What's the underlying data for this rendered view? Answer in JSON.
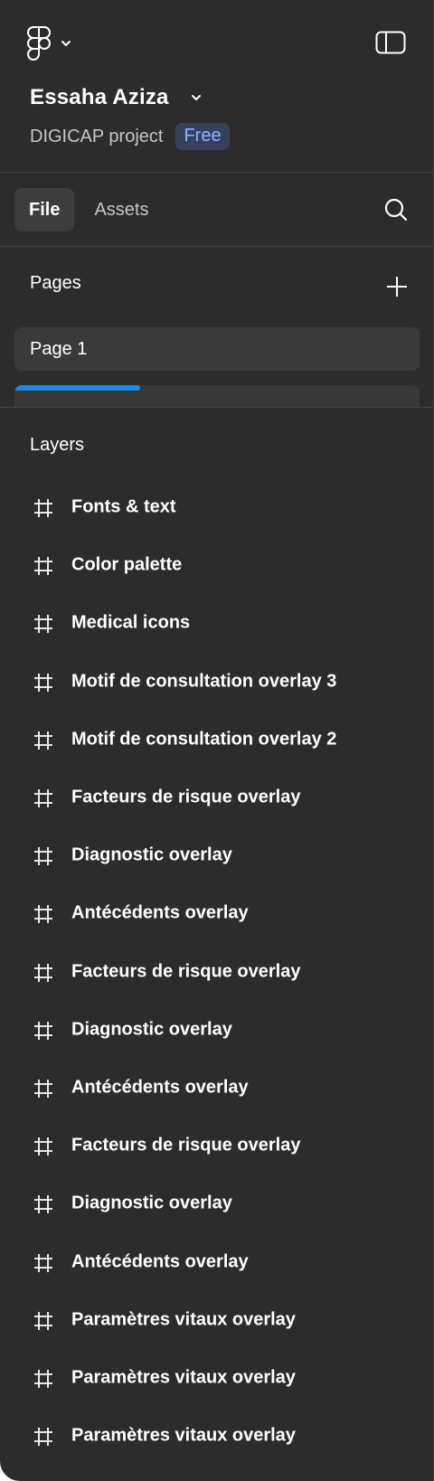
{
  "header": {
    "workspace_name": "Essaha Aziza",
    "project_name": "DIGICAP project",
    "plan_badge": "Free",
    "icons": {
      "logo": "figma-logo-icon",
      "logo_menu": "chevron-down-icon",
      "sidebar_toggle": "sidebar-toggle-icon"
    }
  },
  "tabs": [
    {
      "label": "File",
      "active": true
    },
    {
      "label": "Assets",
      "active": false
    }
  ],
  "pages": {
    "title": "Pages",
    "items": [
      {
        "label": "Page 1",
        "selected": true
      }
    ],
    "scroll_fraction": 0.31
  },
  "layers": {
    "title": "Layers",
    "items": [
      {
        "label": "Fonts & text"
      },
      {
        "label": "Color palette"
      },
      {
        "label": "Medical icons"
      },
      {
        "label": "Motif de consultation overlay 3"
      },
      {
        "label": "Motif de consultation overlay 2"
      },
      {
        "label": "Facteurs de risque overlay"
      },
      {
        "label": "Diagnostic overlay"
      },
      {
        "label": "Antécédents overlay"
      },
      {
        "label": "Facteurs de risque overlay"
      },
      {
        "label": "Diagnostic overlay"
      },
      {
        "label": "Antécédents overlay"
      },
      {
        "label": "Facteurs de risque overlay"
      },
      {
        "label": "Diagnostic overlay"
      },
      {
        "label": "Antécédents overlay"
      },
      {
        "label": "Paramètres vitaux overlay"
      },
      {
        "label": "Paramètres vitaux overlay"
      },
      {
        "label": "Paramètres vitaux overlay"
      }
    ]
  },
  "colors": {
    "panel_bg": "#2c2c2c",
    "accent_blue": "#1e88e5",
    "badge_bg": "#36415e",
    "badge_text": "#8fb4ff"
  }
}
